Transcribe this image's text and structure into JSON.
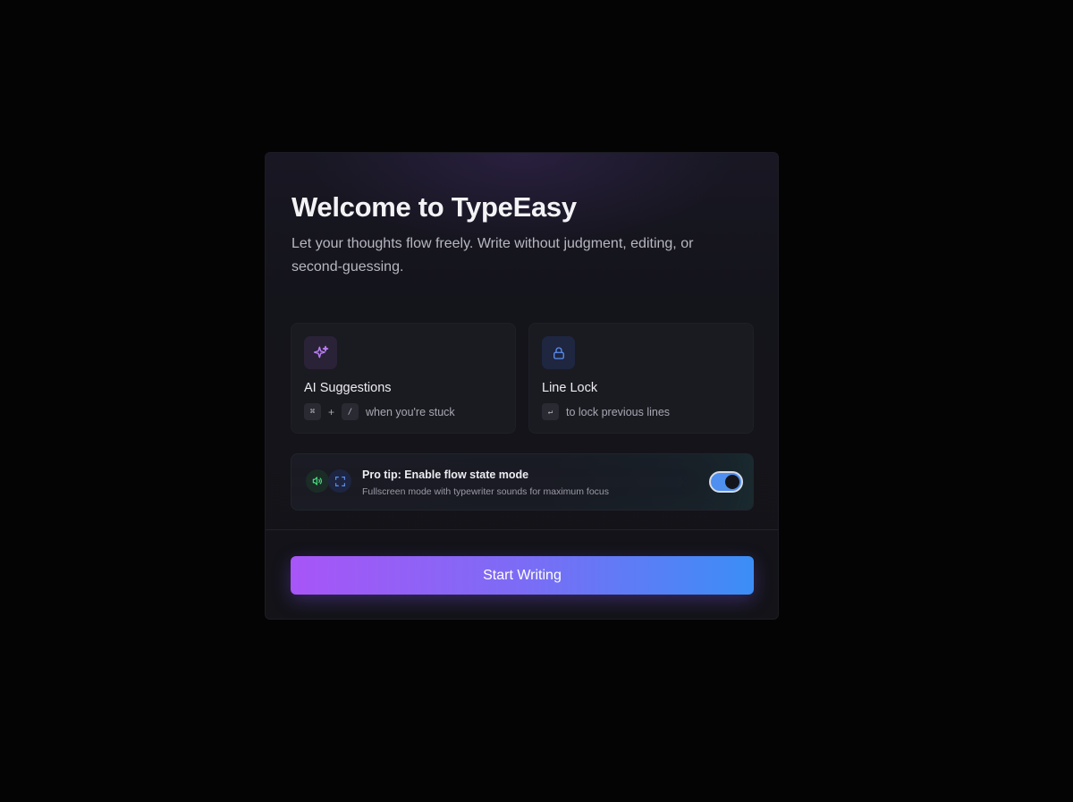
{
  "modal": {
    "title": "Welcome to TypeEasy",
    "subtitle": "Let your thoughts flow freely. Write without judgment, editing, or second-guessing."
  },
  "features": [
    {
      "title": "AI Suggestions",
      "icon": "sparkles-icon",
      "keys": [
        "⌘",
        "/"
      ],
      "separator": "+",
      "hint": "when you're stuck"
    },
    {
      "title": "Line Lock",
      "icon": "lock-icon",
      "keys": [
        "↵"
      ],
      "hint": "to lock previous lines"
    }
  ],
  "tip": {
    "title": "Pro tip: Enable flow state mode",
    "subtitle": "Fullscreen mode with typewriter sounds for maximum focus",
    "icons": [
      "speaker-icon",
      "fullscreen-icon"
    ],
    "toggle_on": true
  },
  "cta": {
    "label": "Start Writing"
  },
  "colors": {
    "background": "#040405",
    "modal": "#14141b",
    "accent_purple": "#a855f7",
    "accent_blue": "#3b8ef6",
    "sound_green": "#4ade80",
    "lock_blue": "#5b8def"
  }
}
